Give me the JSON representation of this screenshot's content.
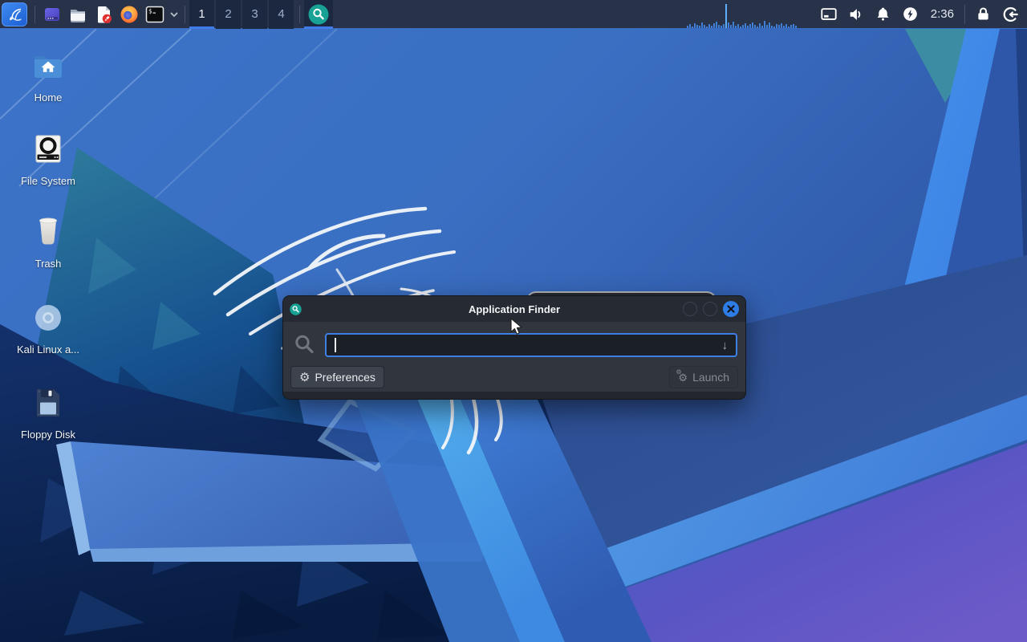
{
  "panel": {
    "launcher_icons": [
      "kali-menu",
      "window-manager",
      "file-manager",
      "text-editor",
      "firefox",
      "terminal"
    ],
    "workspaces": {
      "items": [
        "1",
        "2",
        "3",
        "4"
      ],
      "active_index": 0
    },
    "app_finder_task": "application-finder",
    "cpu_graph": {
      "bars": [
        3,
        5,
        2,
        6,
        4,
        3,
        7,
        4,
        2,
        5,
        3,
        6,
        8,
        4,
        3,
        5,
        30,
        7,
        4,
        8,
        3,
        5,
        2,
        4,
        6,
        3,
        5,
        7,
        4,
        2,
        6,
        3,
        9,
        4,
        7,
        3,
        2,
        5,
        4,
        6,
        3,
        5,
        2,
        4,
        5,
        3
      ]
    },
    "tray_icons": [
      "display",
      "volume",
      "notifications",
      "power-manager",
      "clock",
      "screen-lock",
      "logout"
    ],
    "clock": "2:36"
  },
  "desktop": {
    "icons": [
      {
        "label": "Home"
      },
      {
        "label": "File System"
      },
      {
        "label": "Trash"
      },
      {
        "label": "Kali Linux a..."
      },
      {
        "label": "Floppy Disk"
      }
    ]
  },
  "app_finder": {
    "title": "Application Finder",
    "search_value": "",
    "search_placeholder": "",
    "preferences_label": "Preferences",
    "launch_label": "Launch",
    "window_controls": [
      "minimize",
      "maximize",
      "close"
    ]
  },
  "colors": {
    "accent": "#3d7fe3",
    "panel_bg": "#283349",
    "dialog_bg": "#31363e",
    "titlebar_bg": "#262b33",
    "appfinder_teal": "#17a295",
    "close_button_blue": "#2e7ce6"
  }
}
